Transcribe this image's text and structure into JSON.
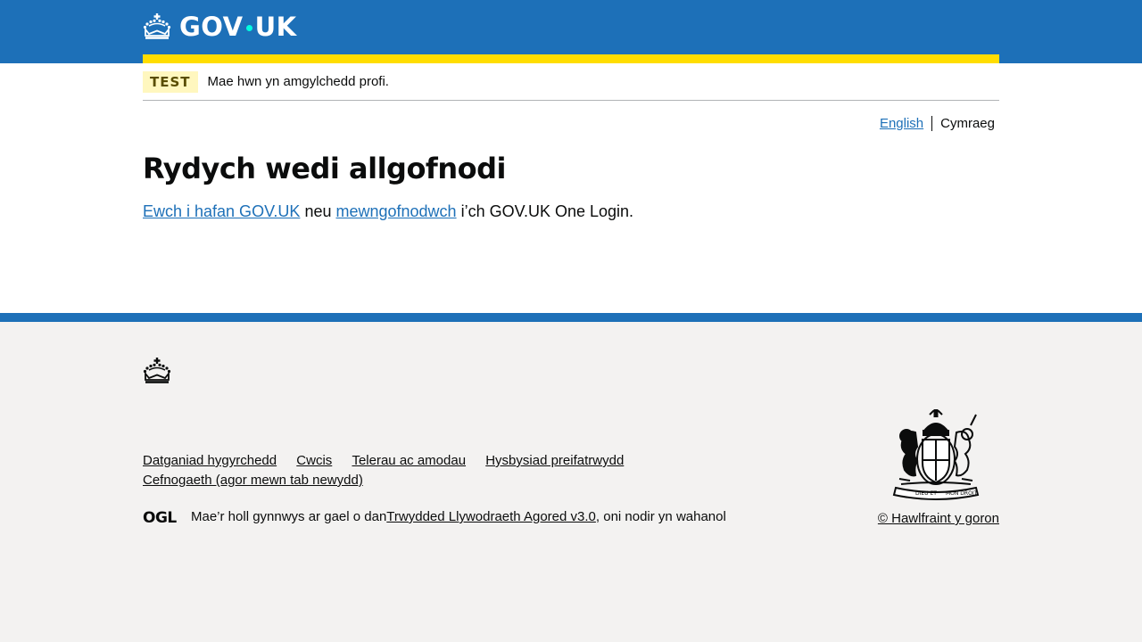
{
  "header": {
    "logo_text_left": "GOV",
    "logo_text_right": "UK"
  },
  "phase_banner": {
    "tag": "TEST",
    "text": "Mae hwn yn amgylchedd profi."
  },
  "language_toggle": {
    "english": "English",
    "cymraeg": "Cymraeg"
  },
  "main": {
    "heading": "Rydych wedi allgofnodi",
    "link_home": "Ewch i hafan GOV.UK",
    "word_or": " neu ",
    "link_signin": "mewngofnodwch",
    "suffix": " i’ch GOV.UK One Login."
  },
  "footer": {
    "links": [
      "Datganiad hygyrchedd",
      "Cwcis",
      "Telerau ac amodau",
      "Hysbysiad preifatrwydd",
      "Cefnogaeth (agor mewn tab newydd)"
    ],
    "licence_prefix": "Mae’r holl gynnwys ar gael o dan ",
    "licence_link": "Trwydded Llywodraeth Agored v3.0",
    "licence_suffix": ", oni nodir yn wahanol",
    "copyright": "© Hawlfraint y goron",
    "ogl_logo_text": "OGL"
  },
  "colors": {
    "brand_blue": "#1d70b8",
    "header_stripe": "#ffdd00",
    "tag_bg": "#fff7bf",
    "link": "#1d70b8",
    "footer_bg": "#f3f2f1"
  }
}
